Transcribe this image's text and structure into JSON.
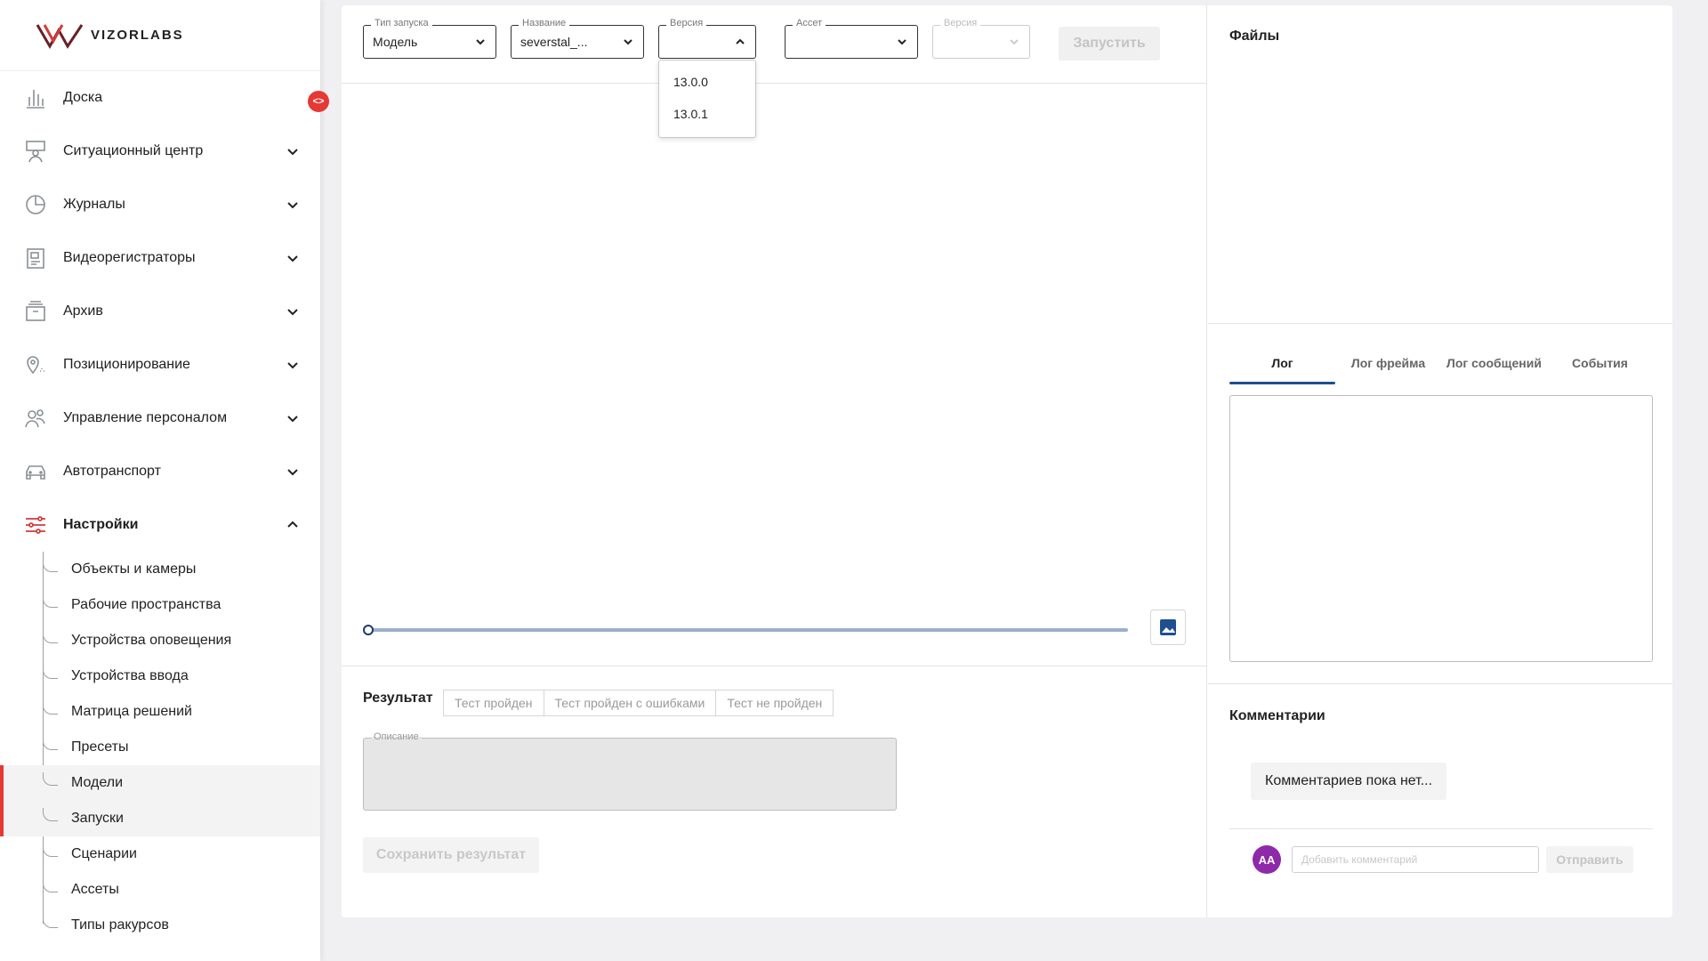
{
  "logo": {
    "text": "VIZORLABS"
  },
  "collapse_toggle": "<>",
  "sidebar": {
    "items": [
      {
        "label": "Доска",
        "icon": "chart-bars-icon"
      },
      {
        "label": "Ситуационный центр",
        "icon": "situation-center-icon"
      },
      {
        "label": "Журналы",
        "icon": "pie-chart-icon"
      },
      {
        "label": "Видеорегистраторы",
        "icon": "video-recorder-icon"
      },
      {
        "label": "Архив",
        "icon": "archive-icon"
      },
      {
        "label": "Позиционирование",
        "icon": "location-pin-icon"
      },
      {
        "label": "Управление персоналом",
        "icon": "people-icon"
      },
      {
        "label": "Автотранспорт",
        "icon": "car-icon"
      },
      {
        "label": "Настройки",
        "icon": "settings-sliders-icon"
      }
    ],
    "settings_sub": [
      {
        "label": "Объекты и камеры"
      },
      {
        "label": "Рабочие пространства"
      },
      {
        "label": "Устройства оповещения"
      },
      {
        "label": "Устройства ввода"
      },
      {
        "label": "Матрица решений"
      },
      {
        "label": "Пресеты"
      },
      {
        "label": "Модели"
      },
      {
        "label": "Запуски"
      },
      {
        "label": "Сценарии"
      },
      {
        "label": "Ассеты"
      },
      {
        "label": "Типы ракурсов"
      }
    ]
  },
  "toolbar": {
    "launch_type": {
      "label": "Тип запуска",
      "value": "Модель"
    },
    "name": {
      "label": "Название",
      "value": "severstal_..."
    },
    "version": {
      "label": "Версия",
      "value": ""
    },
    "asset": {
      "label": "Ассет",
      "value": ""
    },
    "asset_version": {
      "label": "Версия",
      "value": ""
    },
    "run_button": "Запустить"
  },
  "version_dropdown": {
    "options": [
      "13.0.0",
      "13.0.1"
    ]
  },
  "timeline": {
    "position": 0
  },
  "result": {
    "title": "Результат",
    "tabs": [
      "Тест пройден",
      "Тест пройден с ошибками",
      "Тест не пройден"
    ],
    "description_label": "Описание",
    "save_button": "Сохранить результат"
  },
  "right_panel": {
    "files_title": "Файлы",
    "log_tabs": [
      "Лог",
      "Лог фрейма",
      "Лог сообщений",
      "События"
    ],
    "active_log_tab": "Лог",
    "comments_title": "Комментарии",
    "no_comments": "Комментариев пока нет...",
    "avatar_initials": "AA",
    "comment_placeholder": "Добавить комментарий",
    "send_button": "Отправить"
  },
  "colors": {
    "accent": "#e53935",
    "brand_dark": "#6b1f25",
    "tab_active": "#1d4f91",
    "avatar": "#8e2aa8"
  }
}
